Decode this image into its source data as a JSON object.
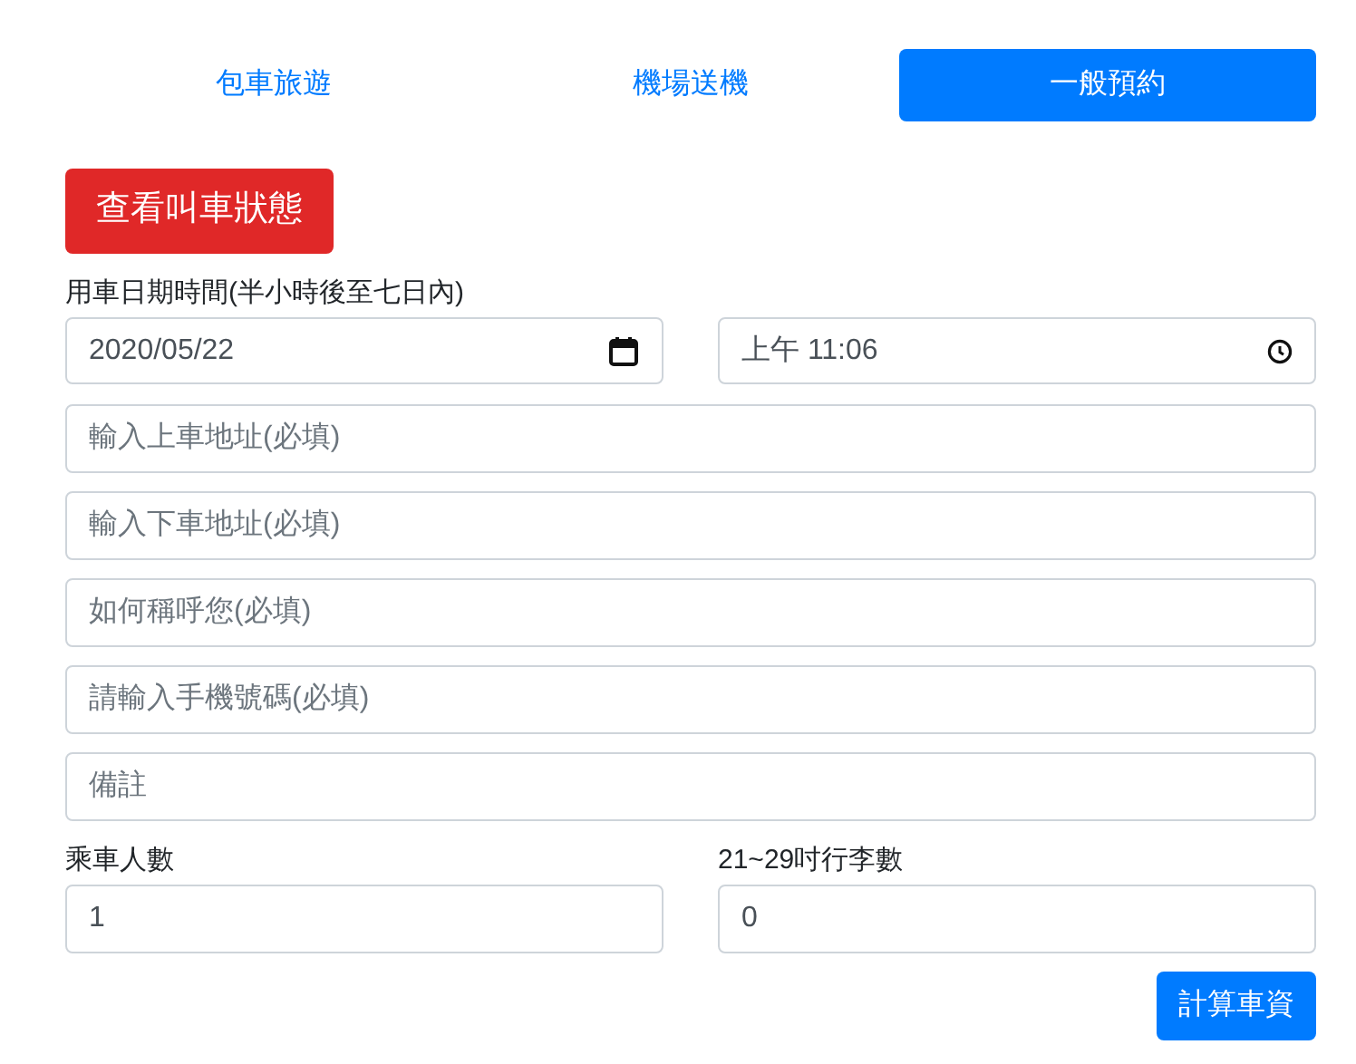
{
  "tabs": [
    {
      "label": "包車旅遊",
      "selected": false
    },
    {
      "label": "機場送機",
      "selected": false
    },
    {
      "label": "一般預約",
      "selected": true
    }
  ],
  "status_button": "查看叫車狀態",
  "datetime": {
    "label": "用車日期時間(半小時後至七日內)",
    "date": "2020/05/22",
    "time": "上午 11:06"
  },
  "fields": [
    {
      "placeholder": "輸入上車地址(必填)"
    },
    {
      "placeholder": "輸入下車地址(必填)"
    },
    {
      "placeholder": "如何稱呼您(必填)"
    },
    {
      "placeholder": "請輸入手機號碼(必填)"
    },
    {
      "placeholder": "備註"
    }
  ],
  "counts": [
    {
      "label": "乘車人數",
      "value": "1"
    },
    {
      "label": "21~29吋行李數",
      "value": "0"
    }
  ],
  "submit_button": "計算車資"
}
